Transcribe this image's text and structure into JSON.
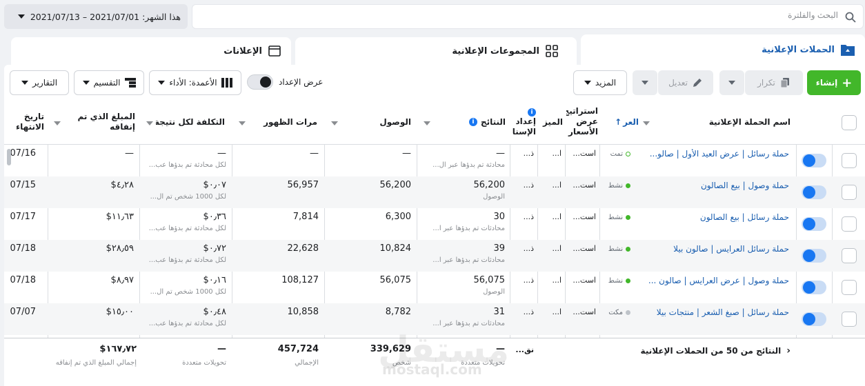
{
  "search": {
    "placeholder": "البحث والفلترة"
  },
  "date_range": {
    "label": "هذا الشهر: 2021/07/01 – 2021/07/13"
  },
  "tabs": [
    {
      "label": "الحملات الإعلانية",
      "icon": "folder-icon",
      "active": true
    },
    {
      "label": "المجموعات الإعلانية",
      "icon": "grid-icon",
      "active": false
    },
    {
      "label": "الإعلانات",
      "icon": "ad-icon",
      "active": false
    }
  ],
  "toolbar": {
    "create": "إنشاء",
    "duplicate": "تكرار",
    "edit": "تعديل",
    "more": "المزيد",
    "view_setup": "عرض الإعداد",
    "columns": "الأعمدة: الأداء",
    "breakdown": "التقسيم",
    "reports": "التقارير"
  },
  "columns": {
    "name": "اسم الحملة الإعلانية",
    "delivery": "العر",
    "bid_strategy": "استراتيج عرض الأسعار",
    "budget": "الميز",
    "attribution": "إعداد الإسنا",
    "results": "النتائج",
    "reach": "الوصول",
    "impressions": "مرات الظهور",
    "cost_per_result": "التكلفة لكل نتيجة",
    "amount_spent": "المبلغ الذي تم إنفاقه",
    "end_date": "تاريخ الانتهاء"
  },
  "rows": [
    {
      "name": "حملة رسائل | عرض العيد الأول | صالو...",
      "status": "تمت",
      "status_color": "#ffffff",
      "bid": "است...",
      "budget": "ا...",
      "attr": "ذ...",
      "results": "—",
      "results_sub": "محادثة تم بدؤها عبر ال...",
      "reach": "—",
      "impressions": "—",
      "cost": "—",
      "cost_sub": "لكل محادثة تم بدؤها عب...",
      "spent": "—",
      "end": "07/16"
    },
    {
      "name": "حملة وصول | بيع الصالون",
      "status": "نشط",
      "status_color": "#42b72a",
      "bid": "است...",
      "budget": "ا...",
      "attr": "ذ...",
      "results": "56,200",
      "results_sub": "الوصول",
      "reach": "56,200",
      "impressions": "56,957",
      "cost": "٠٫٠٧$",
      "cost_sub": "لكل 1000 شخص تم ال...",
      "spent": "٤٫٢٨$",
      "end": "07/15"
    },
    {
      "name": "حملة رسائل | بيع الصالون",
      "status": "نشط",
      "status_color": "#42b72a",
      "bid": "است...",
      "budget": "ا...",
      "attr": "ذ...",
      "results": "30",
      "results_sub": "محادثات تم بدؤها عبر ا...",
      "reach": "6,300",
      "impressions": "7,814",
      "cost": "٠٫٣٦$",
      "cost_sub": "لكل محادثة تم بدؤها عب...",
      "spent": "١١٫٦٣$",
      "end": "07/17"
    },
    {
      "name": "حملة رسائل العرايس | صالون بيلا",
      "status": "نشط",
      "status_color": "#42b72a",
      "bid": "است...",
      "budget": "ا...",
      "attr": "ذ...",
      "results": "39",
      "results_sub": "محادثات تم بدؤها عبر ا...",
      "reach": "10,824",
      "impressions": "22,628",
      "cost": "٠٫٧٢$",
      "cost_sub": "لكل محادثة تم بدؤها عب...",
      "spent": "٢٨٫٥٩$",
      "end": "07/18"
    },
    {
      "name": "حملة وصول | عرض العرايس | صالون ...",
      "status": "نشط",
      "status_color": "#42b72a",
      "bid": "است...",
      "budget": "ا...",
      "attr": "ذ...",
      "results": "56,075",
      "results_sub": "الوصول",
      "reach": "56,075",
      "impressions": "108,127",
      "cost": "٠٫١٦$",
      "cost_sub": "لكل 1000 شخص تم ال...",
      "spent": "٨٫٩٧$",
      "end": "07/18"
    },
    {
      "name": "حملة رسائل | صبغ الشعر | منتجات بيلا",
      "status": "مكت",
      "status_color": "#bec3c9",
      "bid": "است...",
      "budget": "ا...",
      "attr": "ذ...",
      "results": "31",
      "results_sub": "محادثات تم بدؤها عبر ا...",
      "reach": "8,782",
      "impressions": "10,858",
      "cost": "٠٫٤٨$",
      "cost_sub": "لكل محادثة تم بدؤها عب...",
      "spent": "١٥٫٠٠$",
      "end": "07/07"
    }
  ],
  "footer": {
    "summary": "النتائج من 50 من الحملات الإعلانية",
    "attr": "نق...",
    "results": "—",
    "results_sub": "تحويلات متعددة",
    "reach": "339,629",
    "reach_sub": "شخص",
    "impressions": "457,724",
    "impressions_sub": "الإجمالي",
    "cost": "—",
    "cost_sub": "تحويلات متعددة",
    "spent": "١٦٧٫٧٢$",
    "spent_sub": "إجمالي المبلغ الذي تم إنفاقه"
  },
  "watermark": {
    "arabic": "مستقل",
    "latin": "mostaql.com"
  },
  "colors": {
    "accent": "#1b5fb0",
    "create": "#42b72a",
    "toggle": "#1877f2"
  }
}
